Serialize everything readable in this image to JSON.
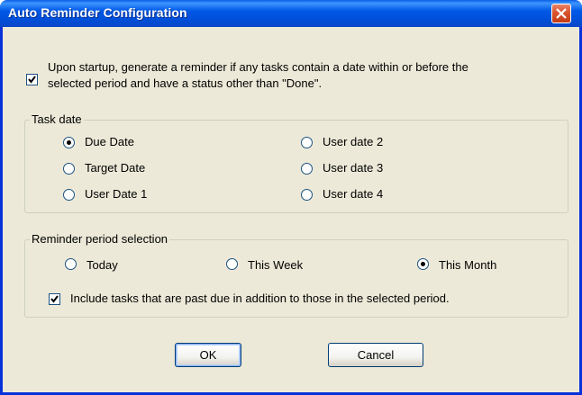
{
  "window": {
    "title": "Auto Reminder Configuration"
  },
  "startup_option": {
    "checked": true,
    "label_line1": "Upon startup, generate a reminder if any tasks contain a date within or before the",
    "label_line2": "selected period and have a status other than \"Done\"."
  },
  "task_date": {
    "legend": "Task date",
    "selected": "Due Date",
    "options": [
      "Due Date",
      "Target Date",
      "User Date 1",
      "User date 2",
      "User date 3",
      "User date 4"
    ]
  },
  "reminder_period": {
    "legend": "Reminder period selection",
    "selected": "This Month",
    "options": [
      "Today",
      "This Week",
      "This Month"
    ],
    "include_past_due": {
      "checked": true,
      "label": "Include tasks that are past due in addition to those in the selected period."
    }
  },
  "buttons": {
    "ok": "OK",
    "cancel": "Cancel"
  },
  "icons": {
    "close": "close-icon",
    "checkmark": "checkmark-icon"
  },
  "colors": {
    "title_bar": "#0058E6",
    "close_button": "#D9532C",
    "dialog_bg": "#ECE9D8"
  }
}
